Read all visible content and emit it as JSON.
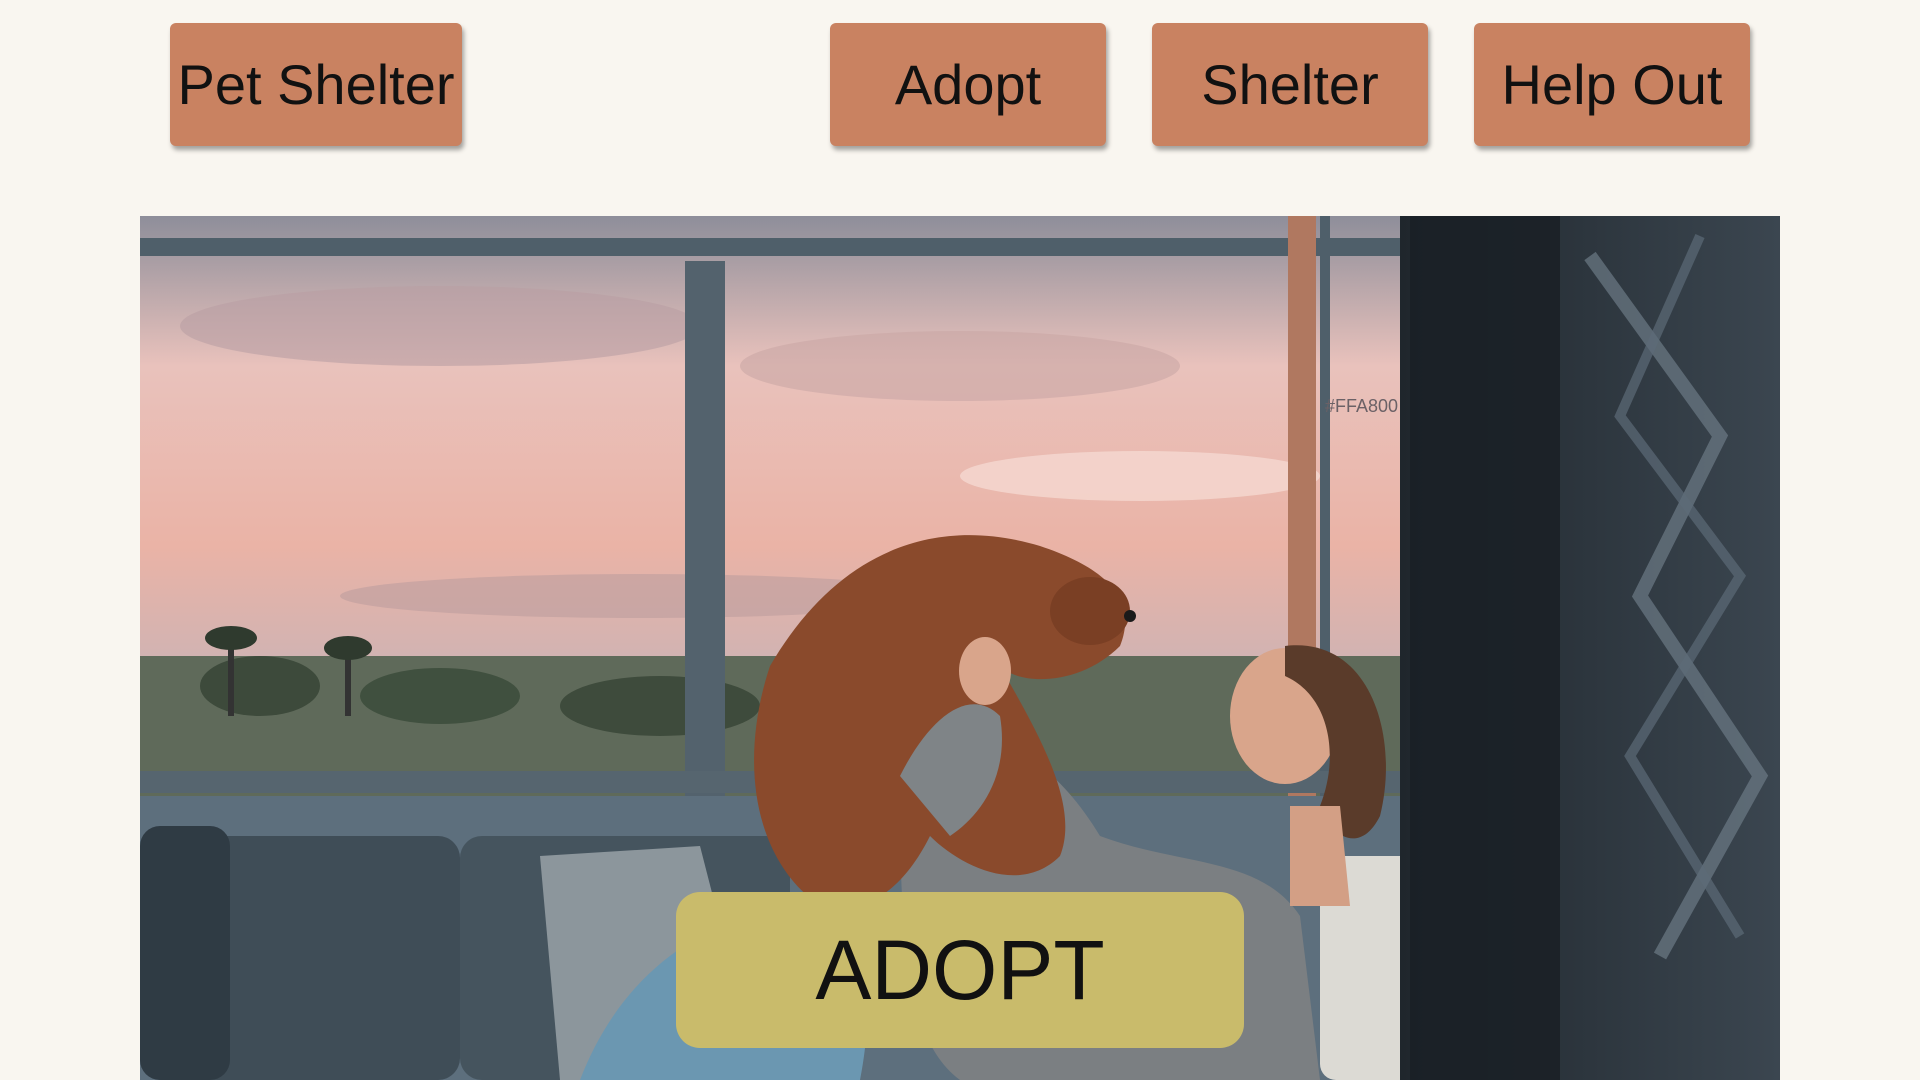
{
  "nav": {
    "brand_label": "Pet Shelter",
    "items": [
      {
        "label": "Adopt"
      },
      {
        "label": "Shelter"
      },
      {
        "label": "Help Out"
      }
    ]
  },
  "hero": {
    "image_caption": "#FFA800",
    "cta_label": "ADOPT"
  },
  "colors": {
    "background": "#f9f6f0",
    "nav_button": "#c98261",
    "cta_button": "#c9bb6b"
  }
}
